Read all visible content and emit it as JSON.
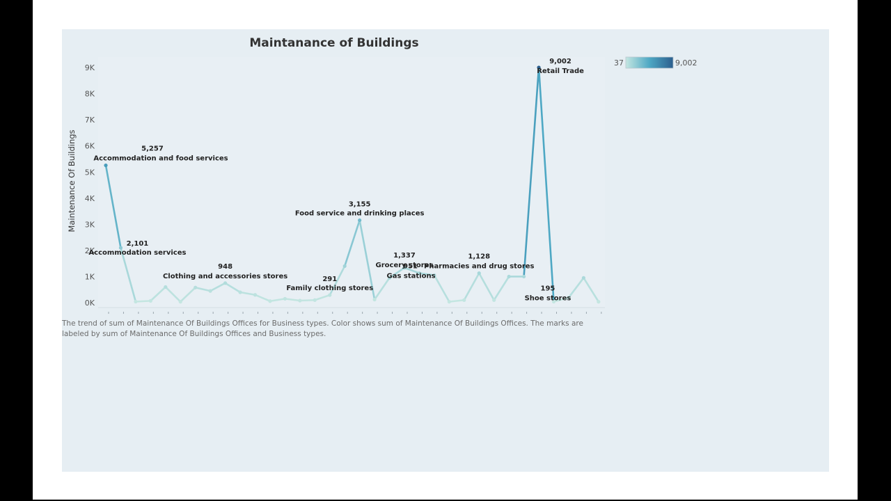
{
  "chart_data": {
    "type": "line",
    "title": "Maintanance of  Buildings",
    "ylabel": "Maintenance Of Buildings",
    "xlabel": "",
    "ylim": [
      0,
      9500
    ],
    "yticks": [
      {
        "value": 0,
        "label": "0K"
      },
      {
        "value": 1000,
        "label": "1K"
      },
      {
        "value": 2000,
        "label": "2K"
      },
      {
        "value": 3000,
        "label": "3K"
      },
      {
        "value": 4000,
        "label": "4K"
      },
      {
        "value": 5000,
        "label": "5K"
      },
      {
        "value": 6000,
        "label": "6K"
      },
      {
        "value": 7000,
        "label": "7K"
      },
      {
        "value": 8000,
        "label": "8K"
      },
      {
        "value": 9000,
        "label": "9K"
      }
    ],
    "grid": false,
    "legend": {
      "type": "color-gradient",
      "position": "top-right",
      "min_label": "37",
      "max_label": "9,002",
      "min_color": "#c4e6e1",
      "max_color": "#2c5f8e"
    },
    "values": [
      5257,
      2101,
      40,
      70,
      600,
      37,
      580,
      450,
      750,
      400,
      300,
      60,
      150,
      80,
      100,
      291,
      1400,
      3155,
      120,
      951,
      1337,
      1130,
      1050,
      37,
      100,
      1128,
      100,
      1000,
      1000,
      9002,
      40,
      195,
      950,
      37
    ],
    "labels": [
      {
        "index": 0,
        "value": "5,257",
        "name": "Accommodation and food services"
      },
      {
        "index": 1,
        "value": "2,101",
        "name": "Accommodation services"
      },
      {
        "index": 8,
        "value": "948",
        "name": "Clothing and accessories stores"
      },
      {
        "index": 15,
        "value": "291",
        "name": "Family clothing stores"
      },
      {
        "index": 17,
        "value": "3,155",
        "name": "Food service and drinking places"
      },
      {
        "index": 19,
        "value": "951",
        "name": "Gas stations"
      },
      {
        "index": 20,
        "value": "1,337",
        "name": "Grocery stores"
      },
      {
        "index": 25,
        "value": "1,128",
        "name": "Pharmacies and drug stores"
      },
      {
        "index": 29,
        "value": "9,002",
        "name": "Retail Trade"
      },
      {
        "index": 31,
        "value": "195",
        "name": "Shoe stores"
      }
    ],
    "caption": "The trend of sum of Maintenance Of Buildings Offices for Business types.  Color shows sum of Maintenance Of Buildings Offices.  The marks are labeled by sum of Maintenance Of Buildings Offices and Business types."
  }
}
